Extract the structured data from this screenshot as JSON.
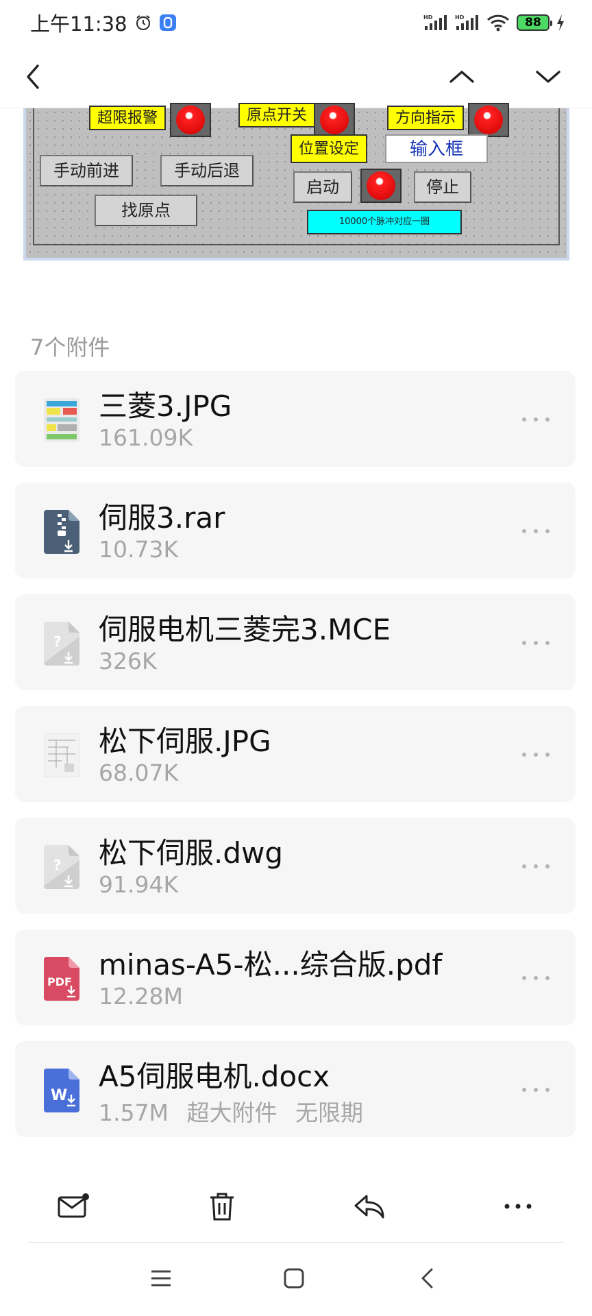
{
  "status_bar": {
    "time": "上午11:38",
    "battery": "88"
  },
  "preview": {
    "labels": {
      "over_limit_alarm": "超限报警",
      "origin_switch": "原点开关",
      "direction": "方向指示",
      "position_set": "位置设定"
    },
    "buttons": {
      "manual_forward": "手动前进",
      "manual_backward": "手动后退",
      "find_origin": "找原点",
      "start": "启动",
      "stop": "停止"
    },
    "input_box": "输入框",
    "pulse_note": "10000个脉冲对应一圈"
  },
  "attachments": {
    "title": "7个附件",
    "items": [
      {
        "name": "三菱3.JPG",
        "size": "161.09K",
        "icon": "image-thumbnail-icon"
      },
      {
        "name": "伺服3.rar",
        "size": "10.73K",
        "icon": "archive-file-icon"
      },
      {
        "name": "伺服电机三菱完3.MCE",
        "size": "326K",
        "icon": "unknown-file-icon"
      },
      {
        "name": "松下伺服.JPG",
        "size": "68.07K",
        "icon": "image-thumbnail-icon"
      },
      {
        "name": "松下伺服.dwg",
        "size": "91.94K",
        "icon": "unknown-file-icon"
      },
      {
        "name": "minas-A5-松...综合版.pdf",
        "size": "12.28M",
        "icon": "pdf-file-icon"
      },
      {
        "name": "A5伺服电机.docx",
        "size": "1.57M",
        "extra1": "超大附件",
        "extra2": "无限期",
        "icon": "word-file-icon"
      }
    ]
  },
  "colors": {
    "accent": "#4a6fd8",
    "card_bg": "#f6f6f6",
    "meta": "#a6a6a6"
  }
}
